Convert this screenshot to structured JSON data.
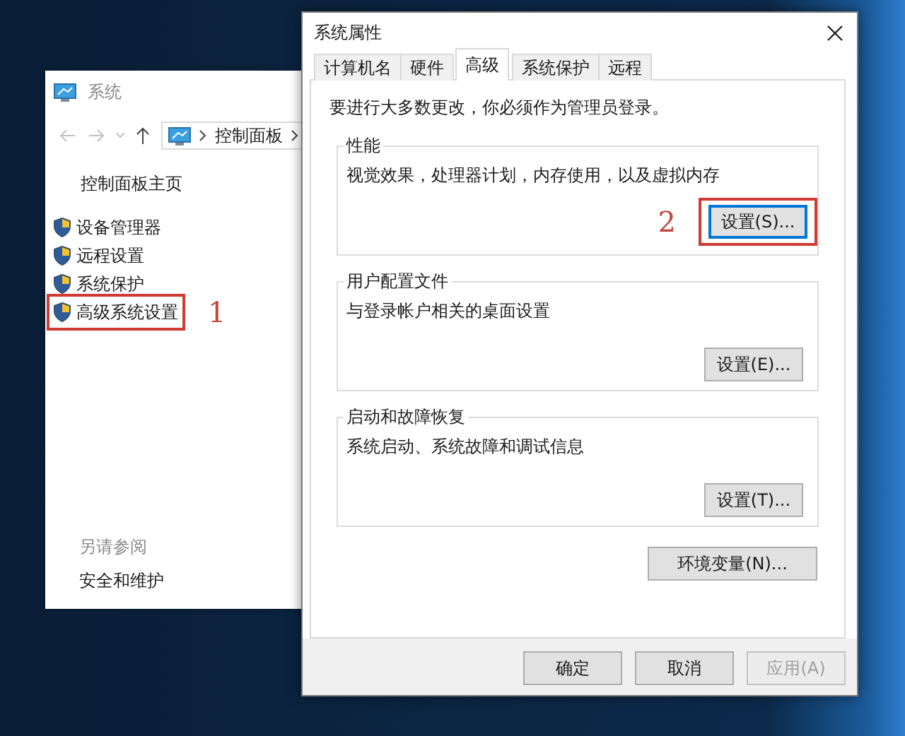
{
  "system_window": {
    "title": "系统",
    "address": [
      "控制面板"
    ],
    "sidebar": {
      "home_link": "控制面板主页",
      "items": [
        {
          "label": "设备管理器",
          "highlighted": false
        },
        {
          "label": "远程设置",
          "highlighted": false
        },
        {
          "label": "系统保护",
          "highlighted": false
        },
        {
          "label": "高级系统设置",
          "highlighted": true,
          "annotation": "1"
        }
      ]
    },
    "see_also": {
      "heading": "另请参阅",
      "links": [
        "安全和维护"
      ]
    }
  },
  "dialog": {
    "title": "系统属性",
    "tabs": [
      {
        "label": "计算机名",
        "selected": false
      },
      {
        "label": "硬件",
        "selected": false
      },
      {
        "label": "高级",
        "selected": true
      },
      {
        "label": "系统保护",
        "selected": false
      },
      {
        "label": "远程",
        "selected": false
      }
    ],
    "notice": "要进行大多数更改，你必须作为管理员登录。",
    "groups": [
      {
        "title": "性能",
        "description": "视觉效果，处理器计划，内存使用，以及虚拟内存",
        "button": {
          "label": "设置(S)...",
          "highlighted": true,
          "annotation": "2"
        }
      },
      {
        "title": "用户配置文件",
        "description": "与登录帐户相关的桌面设置",
        "button": {
          "label": "设置(E)...",
          "highlighted": false
        }
      },
      {
        "title": "启动和故障恢复",
        "description": "系统启动、系统故障和调试信息",
        "button": {
          "label": "设置(T)...",
          "highlighted": false
        }
      }
    ],
    "env_button": "环境变量(N)...",
    "footer_buttons": [
      {
        "label": "确定",
        "disabled": false
      },
      {
        "label": "取消",
        "disabled": false
      },
      {
        "label": "应用(A)",
        "disabled": true
      }
    ]
  }
}
